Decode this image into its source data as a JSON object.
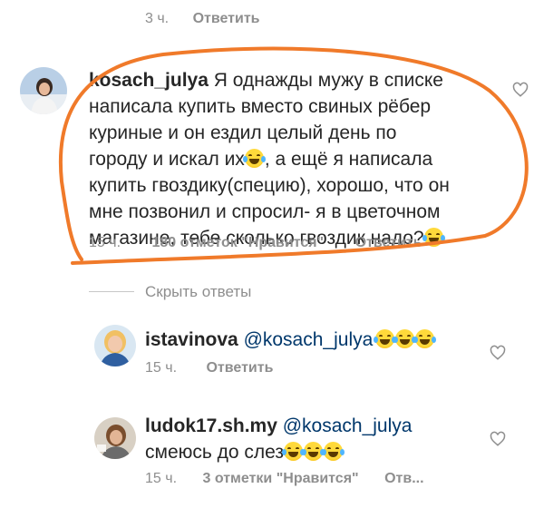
{
  "top_comment": {
    "time": "3 ч.",
    "reply_label": "Ответить"
  },
  "main_comment": {
    "username": "kosach_julya",
    "lines": [
      "Я однажды мужу в списке",
      "написала купить вместо свиных рёбер",
      "куриные и он ездил целый день по",
      "городу и искал их",
      ", а ещё я написала",
      "купить гвоздику(специю), хорошо, что он",
      "мне позвонил и спросил- я в цветочном",
      "магазине,  тебе сколько гвоздик надо?"
    ],
    "time": "15 ч.",
    "likes": "180 отметок \"Нравится\"",
    "reply_label": "Ответить",
    "highlight_color": "#f07a2a"
  },
  "hide_replies_label": "Скрыть ответы",
  "replies": [
    {
      "username": "istavinova",
      "mention": "@kosach_julya",
      "text": "",
      "emoji_count": 3,
      "time": "15 ч.",
      "reply_label": "Ответить"
    },
    {
      "username": "ludok17.sh.my",
      "mention": "@kosach_julya",
      "text": "смеюсь до слез",
      "emoji_count": 3,
      "time": "15 ч.",
      "likes": "3 отметки \"Нравится\"",
      "reply_label": "Отв..."
    }
  ],
  "icons": {
    "heart": "heart-outline-icon",
    "emoji": "face-with-tears-of-joy-icon"
  }
}
